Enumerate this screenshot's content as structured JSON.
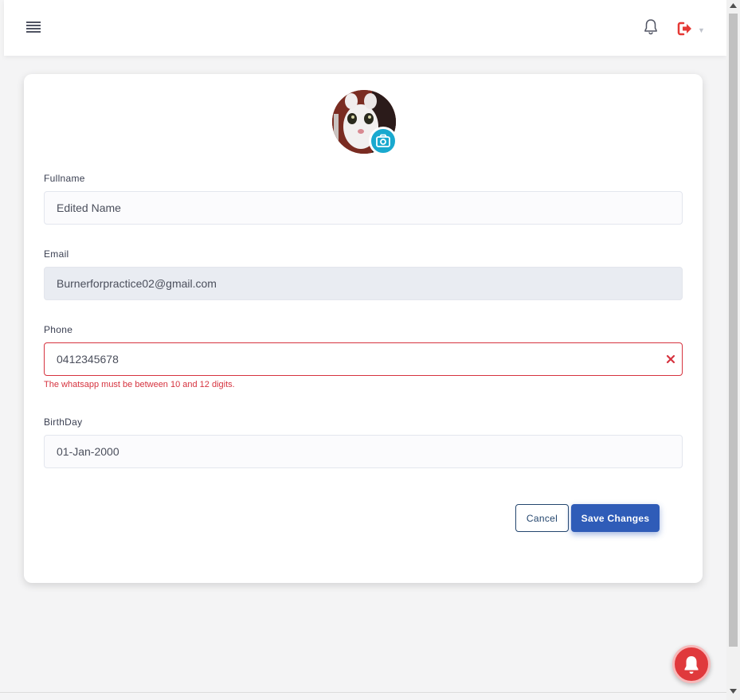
{
  "header": {
    "menu_icon": "hamburger-menu-icon",
    "notification_icon": "bell-icon",
    "logout_icon": "sign-out-icon",
    "logout_color": "#e53935"
  },
  "profile": {
    "avatar_icon": "camera-icon",
    "camera_color": "#19a9cf",
    "fields": {
      "fullname": {
        "label": "Fullname",
        "value": "Edited Name"
      },
      "email": {
        "label": "Email",
        "value": "Burnerforpractice02@gmail.com"
      },
      "phone": {
        "label": "Phone",
        "value": "0412345678",
        "error": "The whatsapp must be between 10 and 12 digits."
      },
      "birthday": {
        "label": "BirthDay",
        "value": "01-Jan-2000"
      }
    },
    "actions": {
      "cancel_label": "Cancel",
      "save_label": "Save Changes"
    }
  },
  "colors": {
    "error": "#d6333f",
    "primary": "#2f5cb8",
    "notification_fab": "#e0393c"
  },
  "notification_fab_icon": "bell-icon"
}
